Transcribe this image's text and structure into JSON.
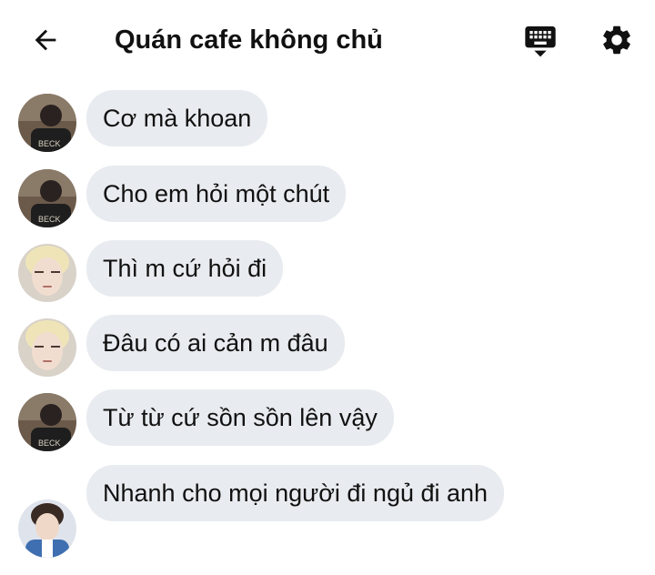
{
  "header": {
    "title": "Quán cafe không chủ",
    "back_icon": "arrow-left-icon",
    "keyboard_icon": "keyboard-icon",
    "settings_icon": "gear-icon"
  },
  "colors": {
    "bubble_bg": "#e8ebef",
    "text": "#111111",
    "background": "#ffffff"
  },
  "messages": [
    {
      "sender": "user-a",
      "text": "Cơ mà khoan"
    },
    {
      "sender": "user-a",
      "text": "Cho em hỏi một chút"
    },
    {
      "sender": "user-b",
      "text": "Thì m cứ hỏi đi"
    },
    {
      "sender": "user-b",
      "text": "Đâu có ai cản m đâu"
    },
    {
      "sender": "user-a",
      "text": "Từ từ cứ sồn sồn lên vậy"
    },
    {
      "sender": "user-c",
      "text": "Nhanh cho mọi người đi ngủ đi anh"
    }
  ]
}
